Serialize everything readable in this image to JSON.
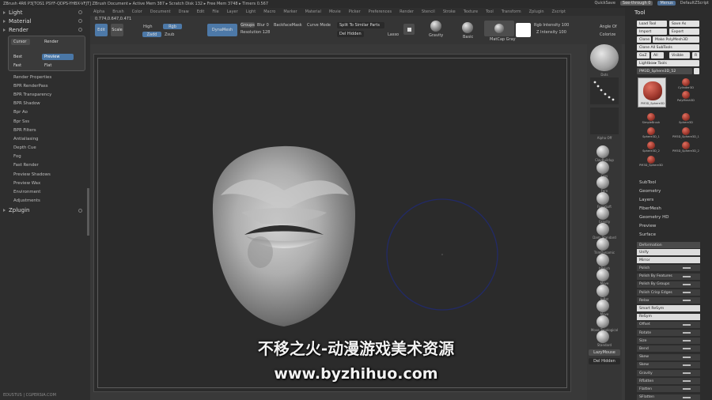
{
  "titlebar": {
    "text": "ZBrush 4R6 P3[TOS1 PSYF-QDPS-YHBX-VFJT]   ZBrush Document   ▸ Active Mem 387 ▸ Scratch Disk 132 ▸ Free Mem 3748 ▸ Timers 0.567",
    "quicksave": "QuickSave",
    "seethrough": "See-through 0",
    "menus": "Menus",
    "script": "DefaultZScript"
  },
  "menubar": [
    "Alpha",
    "Brush",
    "Color",
    "Document",
    "Draw",
    "Edit",
    "File",
    "Layer",
    "Light",
    "Macro",
    "Marker",
    "Material",
    "Movie",
    "Picker",
    "Preferences",
    "Render",
    "Stencil",
    "Stroke",
    "Texture",
    "Tool",
    "Transform",
    "Zplugin",
    "Zscript"
  ],
  "left": {
    "sections": [
      {
        "label": "Light"
      },
      {
        "label": "Material"
      },
      {
        "label": "Render"
      }
    ],
    "render_box": {
      "cursor": "Cursor",
      "render": "Render",
      "best": "Best",
      "preview": "Preview",
      "fast": "Fast",
      "flat": "Flat"
    },
    "items": [
      "Render Properties",
      "BPR RenderPass",
      "BPR Transparency",
      "BPR Shadow",
      "Bpr Ao",
      "Bpr Sss",
      "BPR Filters",
      "Antialiasing",
      "Depth Cue",
      "Fog",
      "Fast Render",
      "Preview Shadows",
      "Preview Wax",
      "Environment",
      "Adjustments"
    ],
    "zplugin": "Zplugin",
    "footer": "EDUSTUS | CGPERSIA.COM"
  },
  "topbar": {
    "coords": "0.774,0.647,0.471",
    "edit": "Edit",
    "scale": "Scale",
    "high": "High",
    "rgb": "Rgb",
    "zadd": "Zadd",
    "zsub": "Zsub",
    "dynamesh": "DynaMesh",
    "groups": "Groups",
    "blur": "Blur 0",
    "resolution": "Resolution 128",
    "backfacemask": "BackfaceMask",
    "curve_mode": "Curve Mode",
    "split": "Split To Similar Parts",
    "del_hidden": "Del Hidden",
    "lasso": "Lasso",
    "gravity": "Gravity",
    "basic": "Basic",
    "matcap": "MatCap Gray",
    "rgb_intensity": "Rgb Intensity 100",
    "z_intensity": "Z Intensity 100",
    "angle": "Angle Of",
    "colorize": "Colorize"
  },
  "shelf": {
    "brushes": [
      "ClayBuildup",
      "Clay",
      "Fern",
      "FormSoft",
      "Gravity",
      "Dam_Standard",
      "TrimDynamic",
      "hPolish",
      "Move",
      "Inflat",
      "Move",
      "Move Topological",
      "Standard"
    ],
    "lazymouse": "LazyMouse",
    "del_hidden": "Del Hidden",
    "labels_top": [
      "Dots",
      "Alpha Off"
    ]
  },
  "tool": {
    "title": "Tool",
    "buttons": [
      [
        "Load Tool",
        "Save As"
      ],
      [
        "Import",
        "Export"
      ],
      [
        "Clone",
        "Make PolyMesh3D"
      ],
      [
        "Clone All SubTools"
      ],
      [
        "GoZ",
        "All",
        "Visible",
        "R"
      ],
      [
        "Lightbox▸ Tools"
      ]
    ],
    "current": "PM3D_Sphere3D_52",
    "thumbs": [
      "PM3D_Sphere3D",
      "Cylinder3D",
      "PolyMesh3D",
      "SimpleBrush",
      "Sphere3D",
      "Sphere3D_1",
      "PM3D_Sphere3D_1",
      "Sphere3D_2",
      "PM3D_Sphere3D_2",
      "PM3D_Sphere3D"
    ],
    "subsections": [
      "SubTool",
      "Geometry",
      "Layers",
      "FiberMesh",
      "Geometry HD",
      "Preview",
      "Surface"
    ],
    "deformation": "Deformation",
    "props": [
      "Unify",
      "Mirror",
      "Polish",
      "Polish By Features",
      "Polish By Groups",
      "Polish Crisp Edges",
      "Relax",
      "Smart ReSym",
      "ReSym",
      "Offset",
      "Rotate",
      "Size",
      "Bend",
      "Skew",
      "Skew",
      "Gravity",
      "Rflatten",
      "Flatten",
      "SFlatten"
    ]
  },
  "watermark": {
    "line1": "不移之火-动漫游戏美术资源",
    "line2": "www.byzhihuo.com"
  },
  "colors": {
    "accent": "#4d79a8",
    "panel": "#2e2e2e",
    "canvas": "#2b2b2b",
    "mesh": "#b8b8b8",
    "brush_ring": "#222a66",
    "subtool_red": "#a23a2f"
  }
}
